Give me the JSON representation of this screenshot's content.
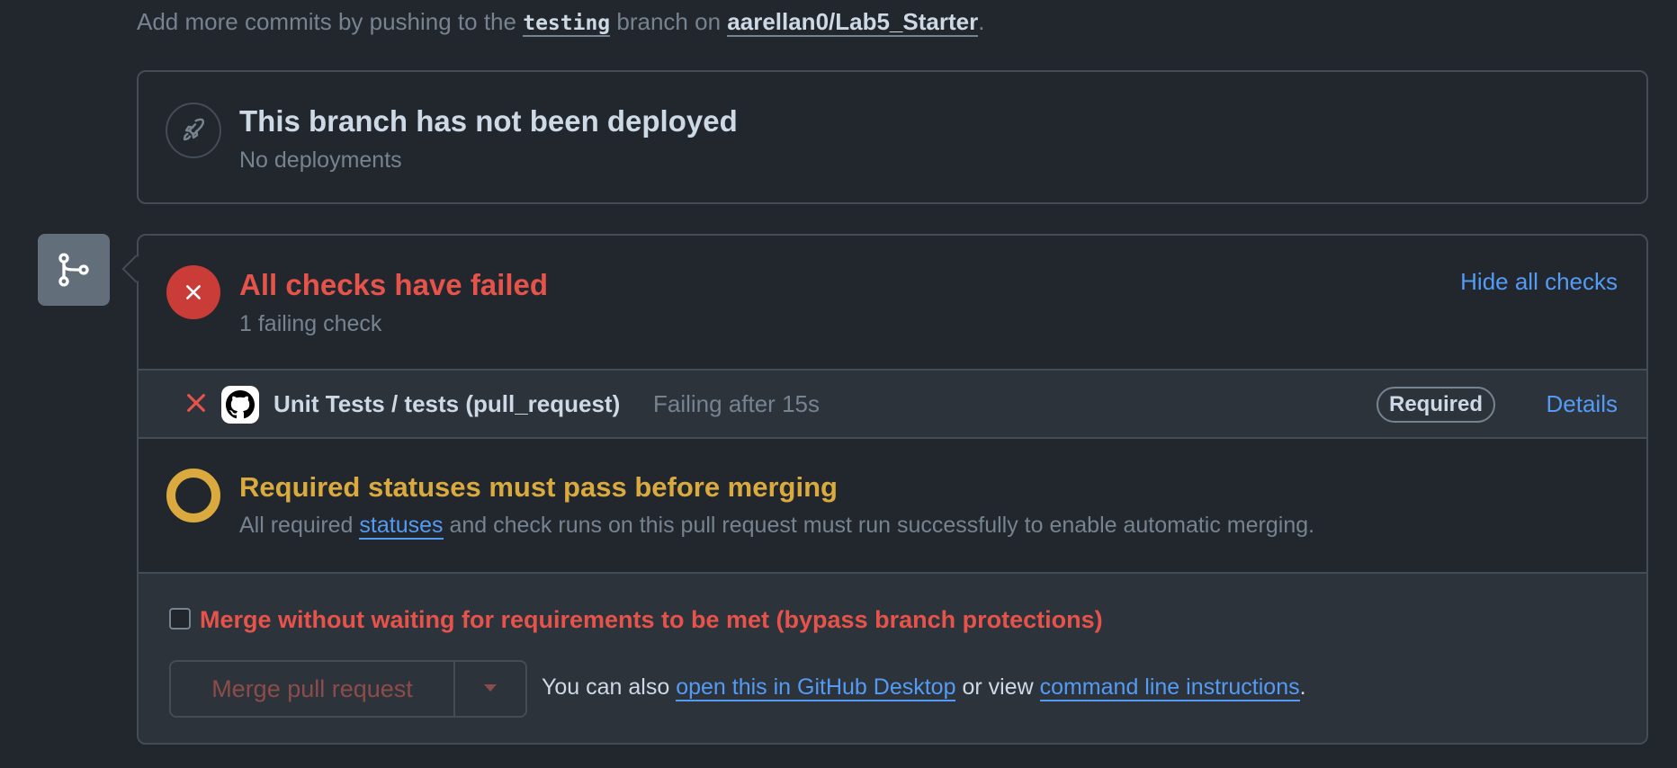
{
  "hint": {
    "prefix": "Add more commits by pushing to the",
    "branch": "testing",
    "middle": "branch on",
    "repo": "aarellan0/Lab5_Starter",
    "suffix": "."
  },
  "deployment": {
    "icon": "rocket-icon",
    "title": "This branch has not been deployed",
    "subtitle": "No deployments"
  },
  "timeline_icon": "git-branch-icon",
  "checks": {
    "icon": "x-circle-icon",
    "title": "All checks have failed",
    "subtitle": "1 failing check",
    "toggle_label": "Hide all checks",
    "items": [
      {
        "status_icon": "x-icon",
        "app_icon": "github-logo-icon",
        "name": "Unit Tests / tests (pull_request)",
        "status": "Failing after 15s",
        "badge": "Required",
        "details_label": "Details"
      }
    ]
  },
  "requirements": {
    "title": "Required statuses must pass before merging",
    "text_prefix": "All required",
    "link": "statuses",
    "text_suffix": "and check runs on this pull request must run successfully to enable automatic merging."
  },
  "merge": {
    "bypass_label": "Merge without waiting for requirements to be met (bypass branch protections)",
    "bypass_checked": false,
    "button_label": "Merge pull request",
    "hint_prefix": "You can also",
    "desktop_link": "open this in GitHub Desktop",
    "hint_middle": "or view",
    "cli_link": "command line instructions",
    "hint_suffix": "."
  },
  "colors": {
    "background": "#22272e",
    "danger": "#e5534b",
    "warning": "#daaa3f",
    "link": "#539bf5"
  }
}
